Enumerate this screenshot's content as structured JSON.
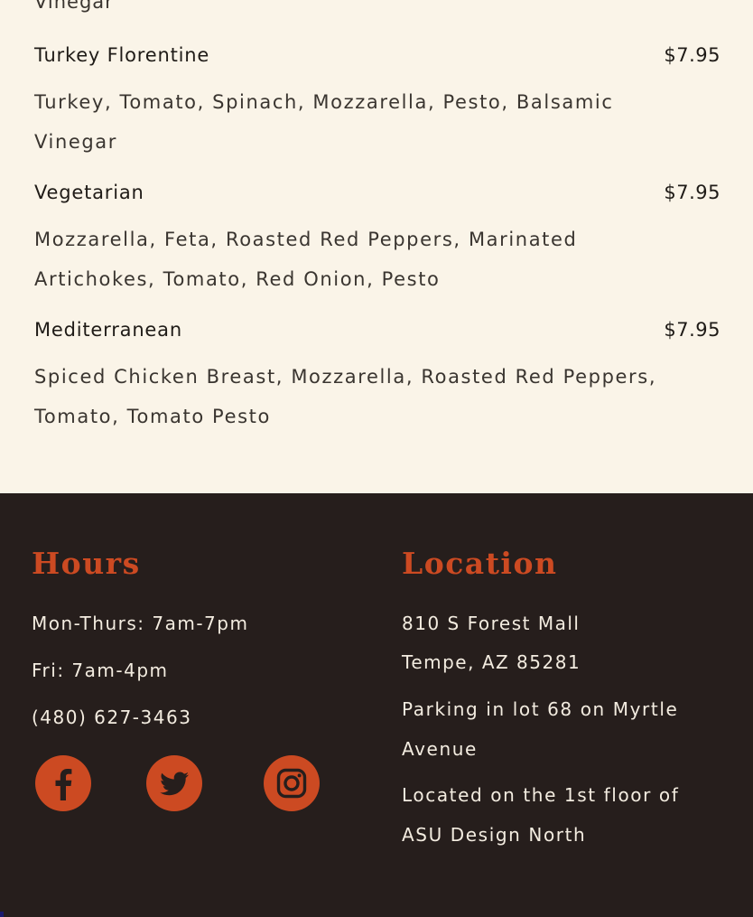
{
  "menu": {
    "cut_text": "Vinegar",
    "items": [
      {
        "name": "Turkey Florentine",
        "price": "$7.95",
        "description": "Turkey, Tomato, Spinach, Mozzarella, Pesto, Balsamic Vinegar"
      },
      {
        "name": "Vegetarian",
        "price": "$7.95",
        "description": "Mozzarella, Feta, Roasted Red Peppers, Marinated Artichokes, Tomato, Red Onion, Pesto"
      },
      {
        "name": "Mediterranean",
        "price": "$7.95",
        "description": "Spiced Chicken Breast, Mozzarella, Roasted Red Peppers, Tomato, Tomato Pesto"
      }
    ]
  },
  "footer": {
    "hours": {
      "heading": "Hours",
      "weekdays": "Mon-Thurs: 7am-7pm",
      "friday": "Fri: 7am-4pm",
      "phone": "(480) 627-3463"
    },
    "location": {
      "heading": "Location",
      "address_line1": "810 S Forest Mall",
      "address_line2": "Tempe, AZ 85281",
      "parking": "Parking in lot 68 on Myrtle Avenue",
      "floor": "Located on the 1st floor of ASU Design North"
    },
    "social": [
      {
        "icon": "facebook-icon"
      },
      {
        "icon": "twitter-icon"
      },
      {
        "icon": "instagram-icon"
      }
    ]
  },
  "colors": {
    "menu_background": "#faf4e8",
    "footer_background": "#261e1c",
    "accent": "#cc4a22",
    "footer_text": "#f3ece0"
  }
}
